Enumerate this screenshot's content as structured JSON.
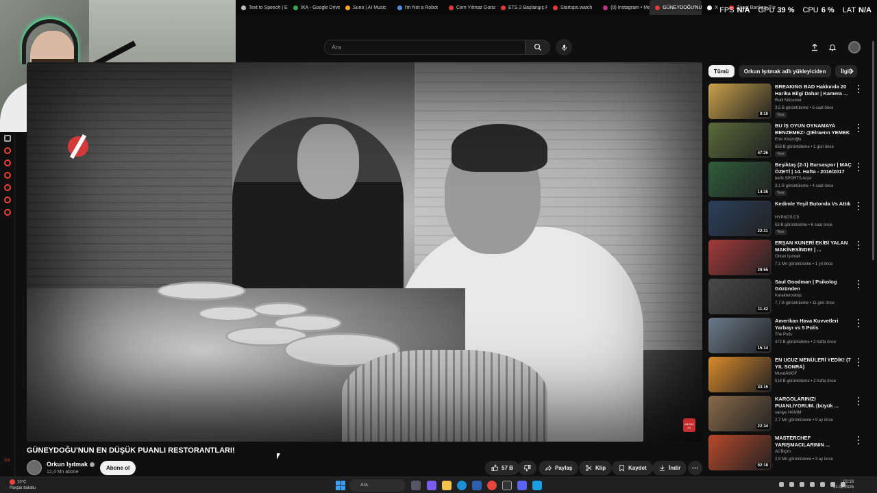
{
  "browser": {
    "tabs": [
      {
        "label": "Text to Speech | El",
        "color": "#bbbbbb"
      },
      {
        "label": "İKA - Google Drive",
        "color": "#34a853"
      },
      {
        "label": "Suno | AI Music",
        "color": "#f5a623"
      },
      {
        "label": "I'm Not a Robot",
        "color": "#4a90e2"
      },
      {
        "label": "Cem Yılmaz Gorsa",
        "color": "#e53935"
      },
      {
        "label": "ETS 2 Başlangıç R",
        "color": "#e53935"
      },
      {
        "label": "Startups.watch",
        "color": "#e53935"
      },
      {
        "label": "(9) Instagram • Me",
        "color": "#c13584"
      },
      {
        "label": "GÜNEYDOĞU'NUN EN",
        "color": "#e53935"
      },
      {
        "label": "X",
        "color": "#ffffff"
      },
      {
        "label": "Ziraat Bankası Türk",
        "color": "#e53935"
      }
    ]
  },
  "overlay_stats": {
    "fps_label": "FPS",
    "fps": "N/A",
    "gpu_label": "GPU",
    "gpu": "39 %",
    "cpu_label": "CPU",
    "cpu": "6 %",
    "lat_label": "LAT",
    "lat": "N/A"
  },
  "header": {
    "search_placeholder": "Ara",
    "icons": [
      "search-icon",
      "mic-icon",
      "upload-icon",
      "bell-icon",
      "account-icon"
    ]
  },
  "video": {
    "title": "GÜNEYDOĞU'NUN EN DÜŞÜK PUANLI RESTORANTLARI!",
    "channel": "Orkun Işıtmak",
    "subscribers": "12,4 Mn abone",
    "subscribe_label": "Abone ol",
    "overlay_sub_text": "ABONE OL"
  },
  "actions": {
    "likes": "57 B",
    "share": "Paylaş",
    "clip": "Klip",
    "save": "Kaydet",
    "download": "İndir"
  },
  "chips": [
    "Tümü",
    "Orkun Işıtmak adlı yükleyiciden",
    "İlgili"
  ],
  "recommendations": [
    {
      "title": "BREAKING BAD Hakkında 20 Harika Bilgi Daha! | Kamera ...",
      "channel": "Ruhi Mücemet",
      "meta": "3,5 B görüntüleme • 6 saat önce",
      "badge": "Yeni",
      "duration": "9:10",
      "thumb": "#c9a24a"
    },
    {
      "title": "BU İŞ OYUN OYNAMAYA BENZEMEZ! @Elraenn YEMEK ...",
      "channel": "Enis Kirazoğlu",
      "meta": "858 B görüntüleme • 1 gün önce",
      "badge": "Yeni",
      "duration": "47:26",
      "thumb": "#5b6b3a"
    },
    {
      "title": "Beşiktaş (2-1) Bursaspor | MAÇ ÖZETİ | 14. Hafta - 2016/2017",
      "channel": "beIN SPORTS Arşiv",
      "meta": "3,1 B görüntüleme • 4 saat önce",
      "badge": "Yeni",
      "duration": "14:35",
      "thumb": "#2f5d3a"
    },
    {
      "title": "Kedimle Yeşil Butonda Vs Attık",
      "channel": "HYPNOS CS",
      "meta": "53 B görüntüleme • 6 saat önce",
      "badge": "Yeni",
      "duration": "22:31",
      "thumb": "#2b3f5c"
    },
    {
      "title": "ERŞAN KUNERİ EKİBİ YALAN MAKİNESİNDE! | ...",
      "channel": "Orkun Işıtmak",
      "meta": "7,1 Mn görüntüleme • 1 yıl önce",
      "badge": "",
      "duration": "29:55",
      "thumb": "#a33a3a"
    },
    {
      "title": "Saul Goodman | Psikolog Gözünden",
      "channel": "Karakteroskop",
      "meta": "7,7 B görüntüleme • 11 gün önce",
      "badge": "",
      "duration": "11:42",
      "thumb": "#4a4a4a"
    },
    {
      "title": "Amerikan Hava Kuvvetleri Yarbayı vs 5 Polis",
      "channel": "The Polis",
      "meta": "472 B görüntüleme • 2 hafta önce",
      "badge": "",
      "duration": "15:14",
      "thumb": "#6a7a8a"
    },
    {
      "title": "EN UCUZ MENÜLERİ YEDİK! (7 YIL SONRA)",
      "channel": "MuratAbiGF",
      "meta": "518 B görüntüleme • 2 hafta önce",
      "badge": "",
      "duration": "33:15",
      "thumb": "#d98a2b"
    },
    {
      "title": "KARGOLARINIZI PUANLIYORUM. (büyük ...",
      "channel": "saniye HANIM",
      "meta": "2,7 Mn görüntüleme • 9 ay önce",
      "badge": "",
      "duration": "22:34",
      "thumb": "#8a6a4a"
    },
    {
      "title": "MASTERCHEF YARIŞMACILARININ ...",
      "channel": "Ali Biçim",
      "meta": "2,9 Mn görüntüleme • 3 ay önce",
      "badge": "",
      "duration": "52:18",
      "thumb": "#b8492b"
    }
  ],
  "taskbar": {
    "weather_temp": "10°C",
    "weather_desc": "Parçalı bulutlu",
    "search_placeholder": "Ara",
    "time": "01:16",
    "date": "21.02.2026"
  },
  "leftbar": {
    "bottom_label": "GX"
  },
  "colors": {
    "background": "#0f0f0f",
    "accent_red": "#e8453c",
    "surface": "#272727"
  }
}
